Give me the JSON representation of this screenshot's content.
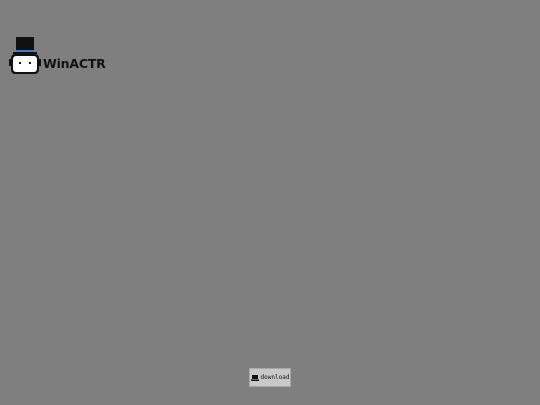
{
  "app": {
    "name": "WinACTR"
  },
  "logo": {
    "icon": "mascot-top-hat-icon",
    "hat_band_color": "#3b7be0"
  },
  "download": {
    "label": "download",
    "icon": "laptop-icon"
  },
  "colors": {
    "background": "#7f7f7f",
    "button": "#c8c8c8"
  }
}
